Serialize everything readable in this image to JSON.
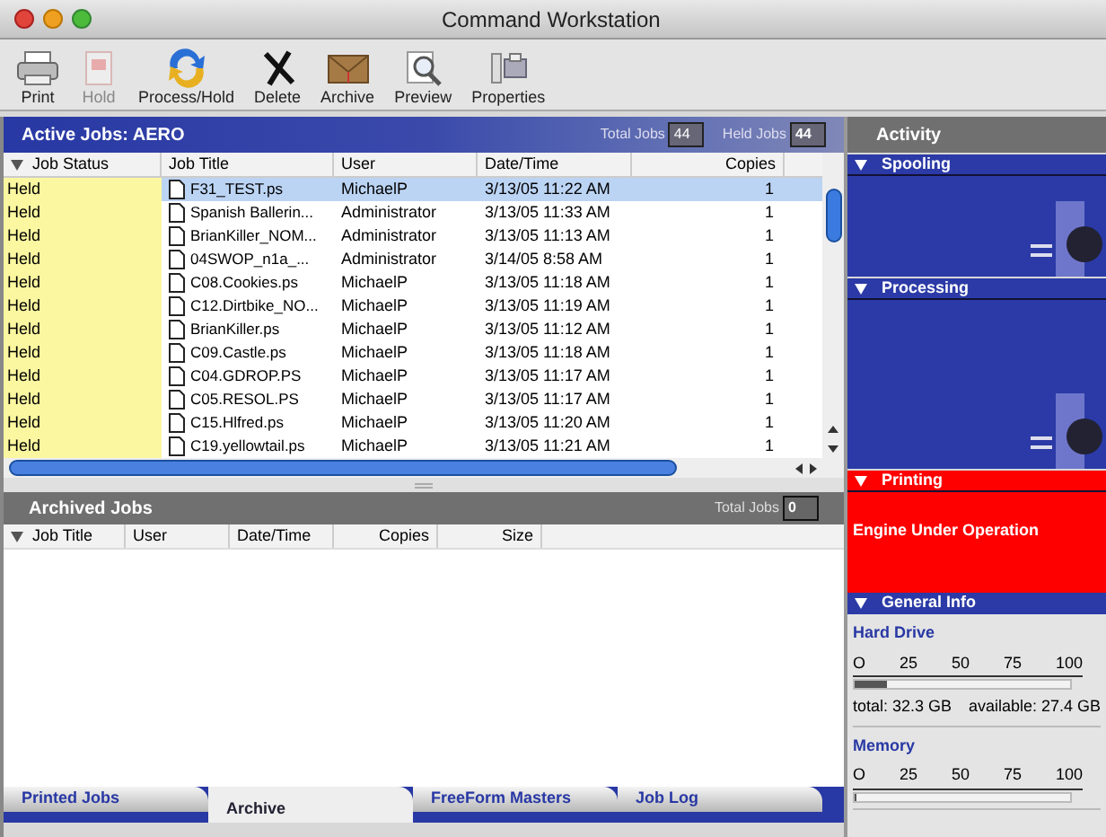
{
  "window": {
    "title": "Command Workstation"
  },
  "toolbar": [
    {
      "kind": "print",
      "label": "Print",
      "disabled": false
    },
    {
      "kind": "hold",
      "label": "Hold",
      "disabled": true
    },
    {
      "kind": "process",
      "label": "Process/Hold",
      "disabled": false
    },
    {
      "kind": "delete",
      "label": "Delete",
      "disabled": false
    },
    {
      "kind": "archive",
      "label": "Archive",
      "disabled": false
    },
    {
      "kind": "preview",
      "label": "Preview",
      "disabled": false
    },
    {
      "kind": "properties",
      "label": "Properties",
      "disabled": false
    }
  ],
  "active_jobs": {
    "title": "Active Jobs:  AERO",
    "total_label": "Total Jobs",
    "total": "44",
    "held_label": "Held Jobs",
    "held": "44",
    "columns": [
      "Job Status",
      "Job Title",
      "User",
      "Date/Time",
      "Copies"
    ],
    "rows": [
      {
        "status": "Held",
        "title": "F31_TEST.ps",
        "user": "MichaelP",
        "date": "3/13/05 11:22 AM",
        "copies": "1",
        "selected": true
      },
      {
        "status": "Held",
        "title": "Spanish Ballerin...",
        "user": "Administrator",
        "date": "3/13/05 11:33 AM",
        "copies": "1",
        "selected": false
      },
      {
        "status": "Held",
        "title": "BrianKiller_NOM...",
        "user": "Administrator",
        "date": "3/13/05 11:13 AM",
        "copies": "1",
        "selected": false
      },
      {
        "status": "Held",
        "title": "04SWOP_n1a_...",
        "user": "Administrator",
        "date": "3/14/05 8:58 AM",
        "copies": "1",
        "selected": false
      },
      {
        "status": "Held",
        "title": "C08.Cookies.ps",
        "user": "MichaelP",
        "date": "3/13/05 11:18 AM",
        "copies": "1",
        "selected": false
      },
      {
        "status": "Held",
        "title": "C12.Dirtbike_NO...",
        "user": "MichaelP",
        "date": "3/13/05 11:19 AM",
        "copies": "1",
        "selected": false
      },
      {
        "status": "Held",
        "title": "BrianKiller.ps",
        "user": "MichaelP",
        "date": "3/13/05 11:12 AM",
        "copies": "1",
        "selected": false
      },
      {
        "status": "Held",
        "title": "C09.Castle.ps",
        "user": "MichaelP",
        "date": "3/13/05 11:18 AM",
        "copies": "1",
        "selected": false
      },
      {
        "status": "Held",
        "title": "C04.GDROP.PS",
        "user": "MichaelP",
        "date": "3/13/05 11:17 AM",
        "copies": "1",
        "selected": false
      },
      {
        "status": "Held",
        "title": "C05.RESOL.PS",
        "user": "MichaelP",
        "date": "3/13/05 11:17 AM",
        "copies": "1",
        "selected": false
      },
      {
        "status": "Held",
        "title": "C15.Hlfred.ps",
        "user": "MichaelP",
        "date": "3/13/05 11:20 AM",
        "copies": "1",
        "selected": false
      },
      {
        "status": "Held",
        "title": "C19.yellowtail.ps",
        "user": "MichaelP",
        "date": "3/13/05 11:21 AM",
        "copies": "1",
        "selected": false
      }
    ]
  },
  "archived_jobs": {
    "title": "Archived Jobs",
    "total_label": "Total Jobs",
    "total": "0",
    "columns": [
      "Job Title",
      "User",
      "Date/Time",
      "Copies",
      "Size"
    ]
  },
  "bottom_tabs": [
    {
      "label": "Printed Jobs",
      "selected": false
    },
    {
      "label": "Archive",
      "selected": true
    },
    {
      "label": "FreeForm Masters",
      "selected": false
    },
    {
      "label": "Job Log",
      "selected": false
    }
  ],
  "activity": {
    "title": "Activity",
    "sections": [
      {
        "kind": "spooling",
        "title": "Spooling"
      },
      {
        "kind": "processing",
        "title": "Processing"
      },
      {
        "kind": "printing",
        "title": "Printing",
        "message": "Engine Under Operation"
      }
    ],
    "general_info": {
      "title": "General Info",
      "meters": [
        {
          "name": "Hard Drive",
          "ticks": [
            "O",
            "25",
            "50",
            "75",
            "100"
          ],
          "level": 0.15,
          "total": "total: 32.3 GB",
          "available": "available: 27.4 GB"
        },
        {
          "name": "Memory",
          "ticks": [
            "O",
            "25",
            "50",
            "75",
            "100"
          ],
          "level": 0.01
        }
      ]
    }
  }
}
